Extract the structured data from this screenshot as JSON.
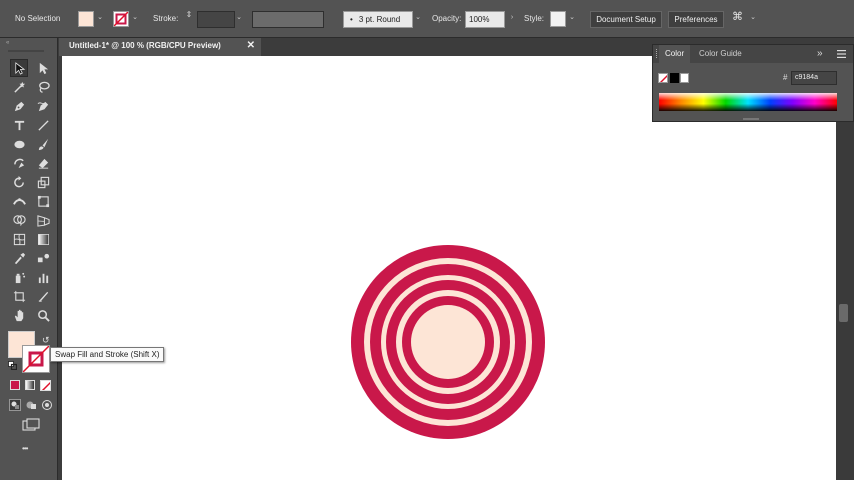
{
  "control_bar": {
    "selection_label": "No Selection",
    "stroke_label": "Stroke:",
    "brush_value": "3 pt. Round",
    "opacity_label": "Opacity:",
    "opacity_value": "100%",
    "style_label": "Style:",
    "document_setup_label": "Document Setup",
    "preferences_label": "Preferences"
  },
  "document": {
    "tab_title": "Untitled-1* @ 100 % (RGB/CPU Preview)",
    "close_glyph": "✕"
  },
  "color_panel": {
    "tabs": [
      "Color",
      "Color Guide"
    ],
    "hash_label": "#",
    "hex_value": "c9184a",
    "overflow_glyph": "»"
  },
  "tooltip": {
    "text": "Swap Fill and Stroke (Shift X)"
  },
  "toolbar": {
    "more_glyph": "•••",
    "tools": [
      "selection-tool",
      "direct-selection-tool",
      "magic-wand-tool",
      "lasso-tool",
      "pen-tool",
      "curvature-tool",
      "type-tool",
      "line-segment-tool",
      "ellipse-tool",
      "paintbrush-tool",
      "shaper-tool",
      "eraser-tool",
      "rotate-tool",
      "scale-tool",
      "width-tool",
      "free-transform-tool",
      "shape-builder-tool",
      "perspective-grid-tool",
      "mesh-tool",
      "gradient-tool",
      "eyedropper-tool",
      "blend-tool",
      "symbol-sprayer-tool",
      "column-graph-tool",
      "artboard-tool",
      "slice-tool",
      "hand-tool",
      "zoom-tool"
    ]
  },
  "colors": {
    "fill": "#fde5d6",
    "ring": "#c9184a",
    "canvas": "#ffffff",
    "ui_bg": "#535353"
  },
  "artwork": {
    "description_shape": "concentric-rings",
    "ring_color": "#c9184a",
    "gap_color": "#fde5d6"
  }
}
